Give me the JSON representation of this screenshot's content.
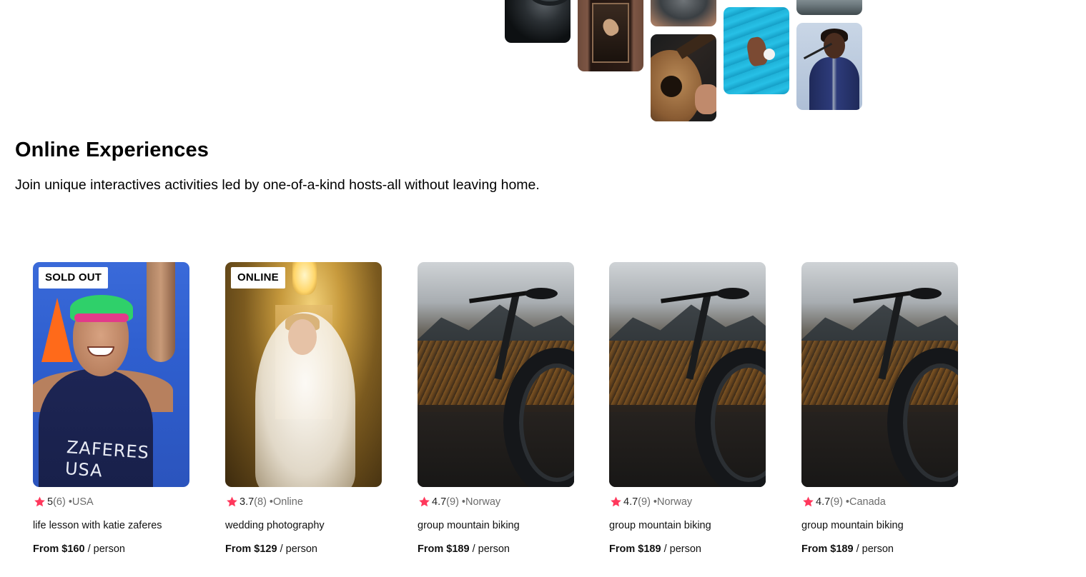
{
  "hero": {
    "photos": [
      {
        "name": "cookware-photo"
      },
      {
        "name": "dancer-doorway-photo"
      },
      {
        "name": "pottery-photo"
      },
      {
        "name": "guitar-photo"
      },
      {
        "name": "swimmer-photo"
      },
      {
        "name": "meditation-photo"
      },
      {
        "name": "singer-photo"
      }
    ]
  },
  "section": {
    "title": "Online Experiences",
    "subtitle": "Join unique interactives activities led by one-of-a-kind hosts-all without leaving home."
  },
  "accent_color": "#ff385c",
  "cards": [
    {
      "badge": "SOLD OUT",
      "rating": "5",
      "reviews": "(6)",
      "location": "•USA",
      "title": "life lesson with katie zaferes",
      "price": "From $160",
      "unit": " / person",
      "image": "athlete"
    },
    {
      "badge": "ONLINE",
      "rating": "3.7",
      "reviews": "(8)",
      "location": "•Online",
      "title": "wedding photography",
      "price": "From $129",
      "unit": " / person",
      "image": "bride"
    },
    {
      "badge": "",
      "rating": "4.7",
      "reviews": "(9)",
      "location": "•Norway",
      "title": "group mountain biking",
      "price": "From $189",
      "unit": " / person",
      "image": "bike"
    },
    {
      "badge": "",
      "rating": "4.7",
      "reviews": "(9)",
      "location": "•Norway",
      "title": "group mountain biking",
      "price": "From $189",
      "unit": " / person",
      "image": "bike"
    },
    {
      "badge": "",
      "rating": "4.7",
      "reviews": "(9)",
      "location": "•Canada",
      "title": "group mountain biking",
      "price": "From $189",
      "unit": " / person",
      "image": "bike"
    }
  ],
  "athlete_shirt_text": "ZAFERES\nUSA"
}
